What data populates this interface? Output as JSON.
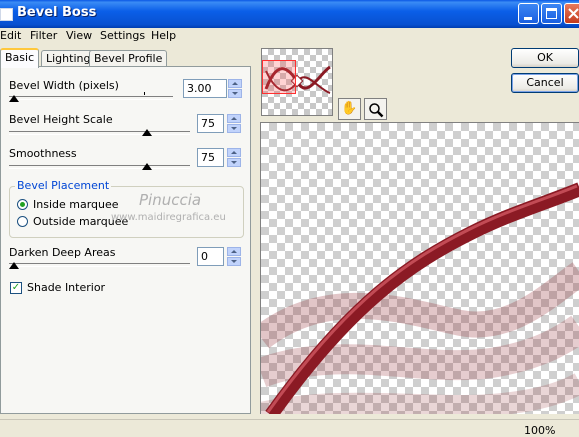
{
  "window": {
    "title": "Bevel Boss"
  },
  "menu": [
    "Edit",
    "Filter",
    "View",
    "Settings",
    "Help"
  ],
  "tabs": [
    "Basic",
    "Lighting",
    "Bevel Profile"
  ],
  "controls": {
    "bevel_width": {
      "label": "Bevel Width (pixels)",
      "value": "3.00"
    },
    "bevel_height_scale": {
      "label": "Bevel Height Scale",
      "value": "75"
    },
    "smoothness": {
      "label": "Smoothness",
      "value": "75"
    },
    "bevel_placement": {
      "title": "Bevel Placement",
      "options": [
        "Inside marquee",
        "Outside marquee"
      ],
      "selected": "Inside marquee"
    },
    "darken_deep_areas": {
      "label": "Darken Deep Areas",
      "value": "0"
    },
    "shade_interior": {
      "label": "Shade Interior",
      "checked": true
    }
  },
  "watermark": {
    "line1": "Pinuccia",
    "line2": "www.maidiregrafica.eu"
  },
  "buttons": {
    "ok": "OK",
    "cancel": "Cancel"
  },
  "status": {
    "zoom": "100%"
  },
  "icons": {
    "hand": "hand-tool-icon",
    "zoom": "magnifier-icon"
  },
  "colors": {
    "ribbon": "#8b1a24",
    "titlebar": "#0a58e4"
  }
}
